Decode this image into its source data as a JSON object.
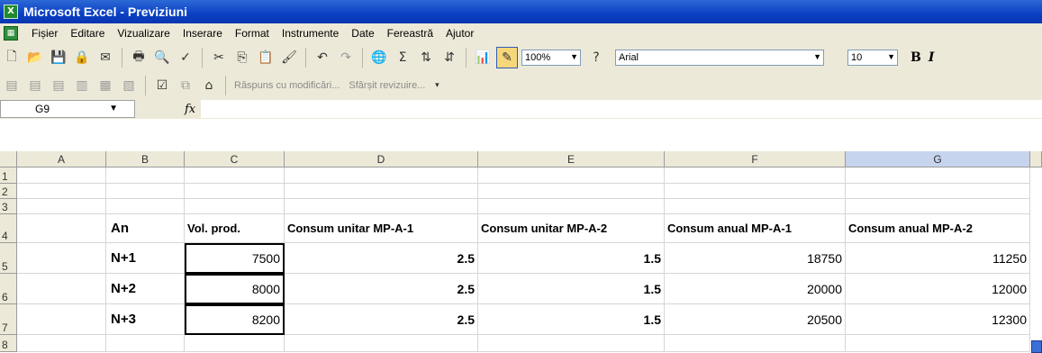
{
  "window": {
    "title": "Microsoft Excel - Previziuni"
  },
  "menu": [
    "Fișier",
    "Editare",
    "Vizualizare",
    "Inserare",
    "Format",
    "Instrumente",
    "Date",
    "Fereastră",
    "Ajutor"
  ],
  "toolbar": {
    "zoom": "100%",
    "font": "Arial",
    "font_size": "10",
    "bold": "B",
    "italic": "I"
  },
  "reviewing": {
    "reply_label": "Răspuns cu modificări...",
    "end_label": "Sfârșit revizuire..."
  },
  "formula_bar": {
    "name_box": "G9",
    "fx": "fx",
    "value": ""
  },
  "columns": [
    "A",
    "B",
    "C",
    "D",
    "E",
    "F",
    "G"
  ],
  "rows": [
    "1",
    "2",
    "3",
    "4",
    "5",
    "6",
    "7",
    "8"
  ],
  "sheet": {
    "headers": {
      "an": "An",
      "vol": "Vol. prod.",
      "cu1": "Consum unitar MP-A-1",
      "cu2": "Consum unitar MP-A-2",
      "ca1": "Consum anual MP-A-1",
      "ca2": "Consum anual MP-A-2"
    },
    "rows": [
      {
        "an": "N+1",
        "vol": "7500",
        "cu1": "2.5",
        "cu2": "1.5",
        "ca1": "18750",
        "ca2": "11250"
      },
      {
        "an": "N+2",
        "vol": "8000",
        "cu1": "2.5",
        "cu2": "1.5",
        "ca1": "20000",
        "ca2": "12000"
      },
      {
        "an": "N+3",
        "vol": "8200",
        "cu1": "2.5",
        "cu2": "1.5",
        "ca1": "20500",
        "ca2": "12300"
      }
    ]
  },
  "colors": {
    "title_bar": "#0a3fc4",
    "chrome": "#ece9d8",
    "selected_header": "#c6d4ee"
  }
}
